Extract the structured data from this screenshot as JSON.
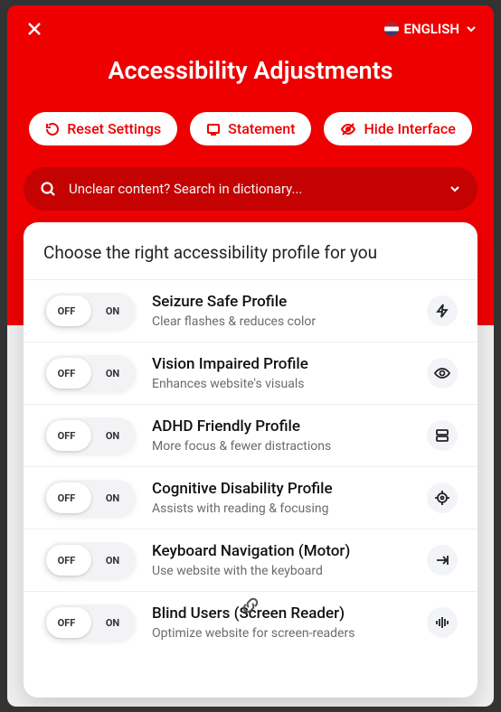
{
  "language": {
    "label": "ENGLISH"
  },
  "title": "Accessibility Adjustments",
  "actions": {
    "reset": "Reset Settings",
    "statement": "Statement",
    "hide": "Hide Interface"
  },
  "search": {
    "placeholder": "Unclear content? Search in dictionary...",
    "value": ""
  },
  "profiles_heading": "Choose the right accessibility profile for you",
  "toggle": {
    "off": "OFF",
    "on": "ON"
  },
  "profiles": [
    {
      "title": "Seizure Safe Profile",
      "desc": "Clear flashes & reduces color"
    },
    {
      "title": "Vision Impaired Profile",
      "desc": "Enhances website's visuals"
    },
    {
      "title": "ADHD Friendly Profile",
      "desc": "More focus & fewer distractions"
    },
    {
      "title": "Cognitive Disability Profile",
      "desc": "Assists with reading & focusing"
    },
    {
      "title": "Keyboard Navigation (Motor)",
      "desc": "Use website with the keyboard"
    },
    {
      "title": "Blind Users (Screen Reader)",
      "desc": "Optimize website for screen-readers"
    }
  ]
}
